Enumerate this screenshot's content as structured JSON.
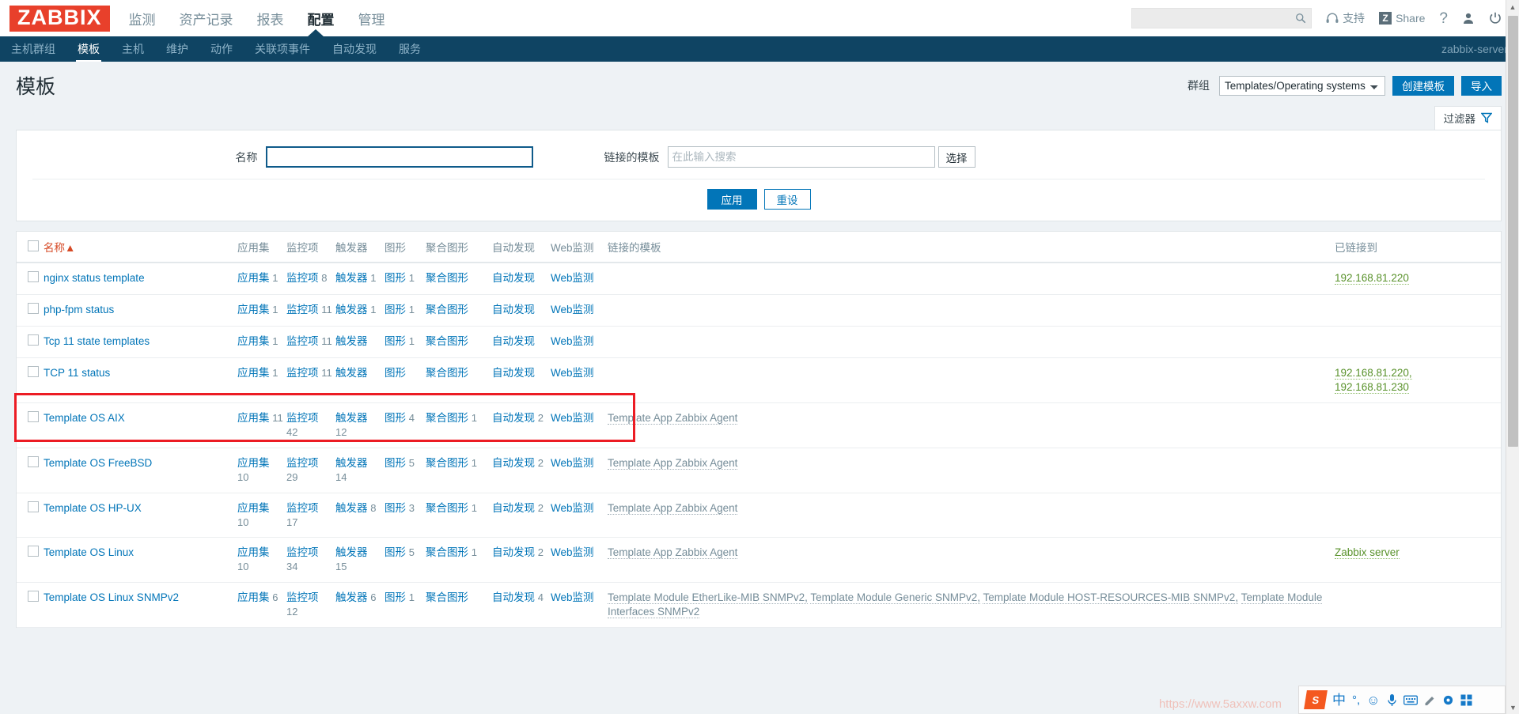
{
  "brand": {
    "logo": "ZABBIX",
    "accent": "#e8402b",
    "nav_bg": "#0f4463",
    "link_color": "#0275b8",
    "green": "#59922b",
    "annotation_color": "#ec1c24"
  },
  "header": {
    "main_nav": [
      {
        "label": "监测",
        "selected": false
      },
      {
        "label": "资产记录",
        "selected": false
      },
      {
        "label": "报表",
        "selected": false
      },
      {
        "label": "配置",
        "selected": true
      },
      {
        "label": "管理",
        "selected": false
      }
    ],
    "search": {
      "value": "",
      "placeholder": "",
      "icon": "search-icon"
    },
    "support_label": "支持",
    "share_label": "Share",
    "share_badge": "Z",
    "help_label": "?",
    "icons": [
      "headset-icon",
      "zabbix-share-icon",
      "question-mark-icon",
      "user-icon",
      "power-icon"
    ]
  },
  "subnav": {
    "items": [
      {
        "label": "主机群组",
        "selected": false
      },
      {
        "label": "模板",
        "selected": true
      },
      {
        "label": "主机",
        "selected": false
      },
      {
        "label": "维护",
        "selected": false
      },
      {
        "label": "动作",
        "selected": false
      },
      {
        "label": "关联项事件",
        "selected": false
      },
      {
        "label": "自动发现",
        "selected": false
      },
      {
        "label": "服务",
        "selected": false
      }
    ],
    "server": "zabbix-server"
  },
  "page": {
    "title": "模板",
    "group_label": "群组",
    "group_value": "Templates/Operating systems",
    "group_options": [
      "Templates/Operating systems"
    ],
    "create_button": "创建模板",
    "import_button": "导入",
    "filter_tab": "过滤器",
    "filter_tab_icon": "filter-icon"
  },
  "filter": {
    "name_label": "名称",
    "name_value": "",
    "linked_label": "链接的模板",
    "linked_value": "",
    "linked_placeholder": "在此输入搜索",
    "select_button": "选择",
    "apply_button": "应用",
    "reset_button": "重设"
  },
  "table": {
    "headers": {
      "name": "名称",
      "sort_arrow": "▲",
      "applications": "应用集",
      "items": "监控项",
      "triggers": "触发器",
      "graphs": "图形",
      "screens": "聚合图形",
      "discovery": "自动发现",
      "web": "Web监测",
      "linked_templates": "链接的模板",
      "linked_to": "已链接到"
    },
    "labels": {
      "applications": "应用集",
      "items": "监控项",
      "triggers": "触发器",
      "graphs": "图形",
      "screens": "聚合图形",
      "discovery": "自动发现",
      "web": "Web监测"
    },
    "rows": [
      {
        "name": "nginx status template",
        "applications": "1",
        "items": "8",
        "triggers": "1",
        "graphs": "1",
        "screens": "",
        "discovery": "",
        "web": "",
        "linked_templates": [],
        "linked_to": [
          "192.168.81.220"
        ],
        "highlighted": false
      },
      {
        "name": "php-fpm status",
        "applications": "1",
        "items": "11",
        "triggers": "1",
        "graphs": "1",
        "screens": "",
        "discovery": "",
        "web": "",
        "linked_templates": [],
        "linked_to": [],
        "highlighted": true
      },
      {
        "name": "Tcp 11 state templates",
        "applications": "1",
        "items": "11",
        "triggers": "",
        "graphs": "1",
        "screens": "",
        "discovery": "",
        "web": "",
        "linked_templates": [],
        "linked_to": [],
        "highlighted": false
      },
      {
        "name": "TCP 11 status",
        "applications": "1",
        "items": "11",
        "triggers": "",
        "graphs": "",
        "screens": "",
        "discovery": "",
        "web": "",
        "linked_templates": [],
        "linked_to": [
          "192.168.81.220,",
          "192.168.81.230"
        ],
        "highlighted": false
      },
      {
        "name": "Template OS AIX",
        "applications": "11",
        "items": "42",
        "triggers": "12",
        "graphs": "4",
        "screens": "1",
        "discovery": "2",
        "web": "",
        "linked_templates": [
          "Template App Zabbix Agent"
        ],
        "linked_to": [],
        "highlighted": false
      },
      {
        "name": "Template OS FreeBSD",
        "applications": "10",
        "items": "29",
        "triggers": "14",
        "graphs": "5",
        "screens": "1",
        "discovery": "2",
        "web": "",
        "linked_templates": [
          "Template App Zabbix Agent"
        ],
        "linked_to": [],
        "highlighted": false
      },
      {
        "name": "Template OS HP-UX",
        "applications": "10",
        "items": "17",
        "triggers": "8",
        "graphs": "3",
        "screens": "1",
        "discovery": "2",
        "web": "",
        "linked_templates": [
          "Template App Zabbix Agent"
        ],
        "linked_to": [],
        "highlighted": false
      },
      {
        "name": "Template OS Linux",
        "applications": "10",
        "items": "34",
        "triggers": "15",
        "graphs": "5",
        "screens": "1",
        "discovery": "2",
        "web": "",
        "linked_templates": [
          "Template App Zabbix Agent"
        ],
        "linked_to": [
          "Zabbix server"
        ],
        "highlighted": false
      },
      {
        "name": "Template OS Linux SNMPv2",
        "applications": "6",
        "items": "12",
        "triggers": "6",
        "graphs": "1",
        "screens": "",
        "discovery": "4",
        "web": "",
        "linked_templates": [
          "Template Module EtherLike-MIB SNMPv2,",
          "Template Module Generic SNMPv2,",
          "Template Module HOST-RESOURCES-MIB SNMPv2,",
          "Template Module Interfaces SNMPv2"
        ],
        "linked_to": [],
        "highlighted": false
      }
    ]
  },
  "ime": {
    "logo": "S",
    "mode": "中",
    "punct": "°,",
    "items": [
      "sogou-logo-icon",
      "chinese-mode-icon",
      "punctuation-icon",
      "emoji-icon",
      "microphone-icon",
      "keyboard-icon",
      "handwriting-icon",
      "toolbox-icon",
      "apps-icon"
    ]
  },
  "watermark": "https://www.5axxw.com"
}
